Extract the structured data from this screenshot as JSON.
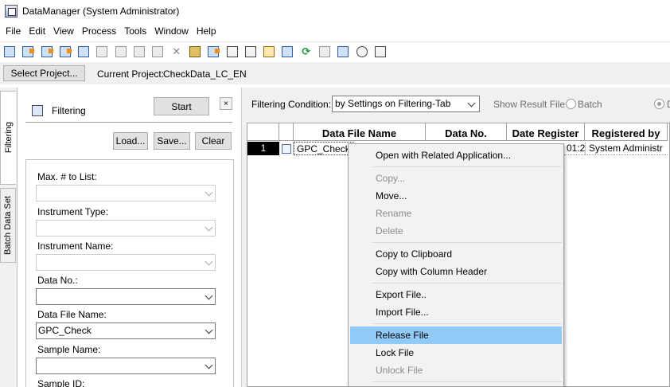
{
  "window": {
    "title": "DataManager (System Administrator)"
  },
  "menubar": {
    "items": [
      "File",
      "Edit",
      "View",
      "Process",
      "Tools",
      "Window",
      "Help"
    ]
  },
  "toolbar": {
    "icons": [
      "open-file-icon",
      "open-import-icon",
      "open-export-icon",
      "open-template-icon",
      "data-browser-icon",
      "batch-icon",
      "print-icon",
      "copy-icon",
      "paste-icon",
      "delete-icon",
      "lock-icon",
      "filter-icon",
      "move-down-icon",
      "move-up-icon",
      "calendar-icon",
      "search-icon",
      "refresh-icon",
      "checkbox-icon",
      "mail-icon",
      "disc-icon",
      "report-icon"
    ]
  },
  "project": {
    "select_label": "Select Project...",
    "current_label": "Current Project:",
    "current_value": "CheckData_LC_EN"
  },
  "side_tabs": {
    "filtering": "Filtering",
    "batch": "Batch Data Set"
  },
  "filter_panel": {
    "title": "Filtering",
    "start_label": "Start",
    "close_label": "×",
    "load_label": "Load...",
    "save_label": "Save...",
    "clear_label": "Clear",
    "fields": [
      {
        "label": "Max. # to List:",
        "value": "",
        "enabled": false
      },
      {
        "label": "Instrument Type:",
        "value": "",
        "enabled": false
      },
      {
        "label": "Instrument Name:",
        "value": "",
        "enabled": false
      },
      {
        "label": "Data No.:",
        "value": "",
        "enabled": true
      },
      {
        "label": "Data File Name:",
        "value": "GPC_Check",
        "enabled": true
      },
      {
        "label": "Sample Name:",
        "value": "",
        "enabled": true
      },
      {
        "label": "Sample ID:",
        "value": "",
        "enabled": true
      }
    ]
  },
  "results": {
    "condition_label": "Filtering Condition:",
    "condition_value": "by Settings on Filtering-Tab",
    "show_result_label": "Show Result File",
    "batch_label": "Batch",
    "d_label": "D",
    "columns": [
      "Data File Name",
      "Data No.",
      "Date Register",
      "Registered by"
    ],
    "rows": [
      {
        "num": "1",
        "file_name": "GPC_Check",
        "date_fragment": "01:2",
        "registered_by": "System Administr"
      }
    ]
  },
  "context_menu": {
    "items": [
      {
        "label": "Open with Related Application...",
        "disabled": false
      },
      {
        "label": "Copy...",
        "disabled": true
      },
      {
        "label": "Move...",
        "disabled": false
      },
      {
        "label": "Rename",
        "disabled": true
      },
      {
        "label": "Delete",
        "disabled": true
      },
      {
        "label": "Copy to Clipboard",
        "disabled": false
      },
      {
        "label": "Copy with Column Header",
        "disabled": false
      },
      {
        "label": "Export File..",
        "disabled": false
      },
      {
        "label": "Import File...",
        "disabled": false
      },
      {
        "label": "Release File",
        "disabled": false,
        "highlighted": true
      },
      {
        "label": "Lock File",
        "disabled": false
      },
      {
        "label": "Unlock File",
        "disabled": true
      }
    ]
  }
}
